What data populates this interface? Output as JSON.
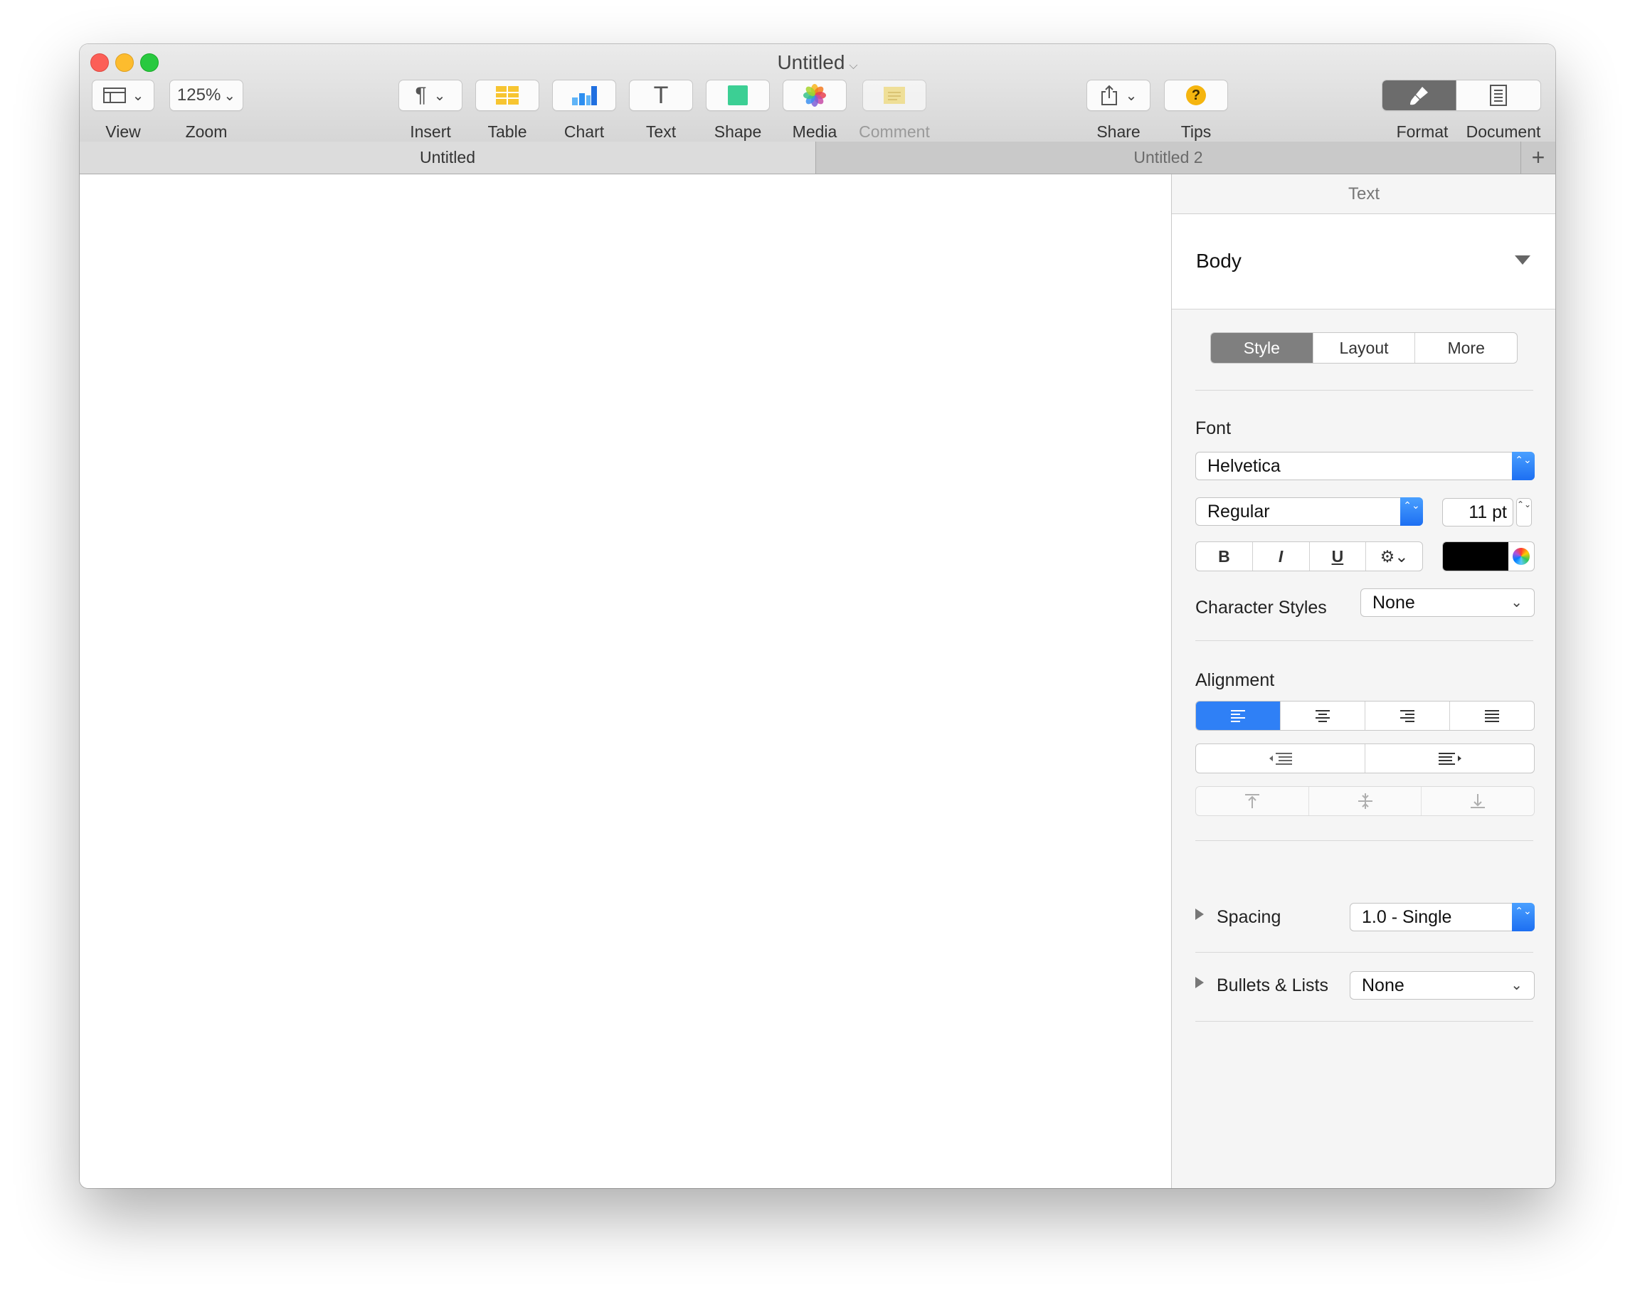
{
  "window": {
    "title": "Untitled",
    "title_chevron": "⌵"
  },
  "toolbar": {
    "view": {
      "label": "View",
      "icon": "sidebar-layout-icon",
      "chevron": "⌄"
    },
    "zoom": {
      "label": "Zoom",
      "value": "125%",
      "chevron": "⌄"
    },
    "insert": {
      "label": "Insert",
      "glyph": "¶",
      "chevron": "⌄"
    },
    "table": {
      "label": "Table",
      "color": "#f7c531"
    },
    "chart": {
      "label": "Chart",
      "color": "#2e8ff0"
    },
    "text": {
      "label": "Text",
      "glyph": "T"
    },
    "shape": {
      "label": "Shape",
      "color": "#3ccf94"
    },
    "media": {
      "label": "Media"
    },
    "comment": {
      "label": "Comment",
      "color": "#f6df7a"
    },
    "share": {
      "label": "Share"
    },
    "tips": {
      "label": "Tips",
      "glyph": "?",
      "color": "#f5b50f"
    },
    "format": {
      "label": "Format"
    },
    "document": {
      "label": "Document"
    }
  },
  "tabs": {
    "items": [
      {
        "label": "Untitled",
        "active": true
      },
      {
        "label": "Untitled 2",
        "active": false
      }
    ],
    "add": "+"
  },
  "sidebar": {
    "header": "Text",
    "paragraph_style": "Body",
    "segments": [
      "Style",
      "Layout",
      "More"
    ],
    "font": {
      "heading": "Font",
      "family": "Helvetica",
      "typeface": "Regular",
      "size": "11 pt",
      "bold": "B",
      "italic": "I",
      "underline": "U",
      "options": "⚙︎⌄",
      "color": "#000000"
    },
    "character_styles": {
      "label": "Character Styles",
      "value": "None"
    },
    "alignment": {
      "heading": "Alignment",
      "accent": "#2f80f6"
    },
    "spacing": {
      "label": "Spacing",
      "value": "1.0 - Single"
    },
    "bullets": {
      "label": "Bullets & Lists",
      "value": "None"
    },
    "stepper_glyph": "⌃⌄"
  }
}
